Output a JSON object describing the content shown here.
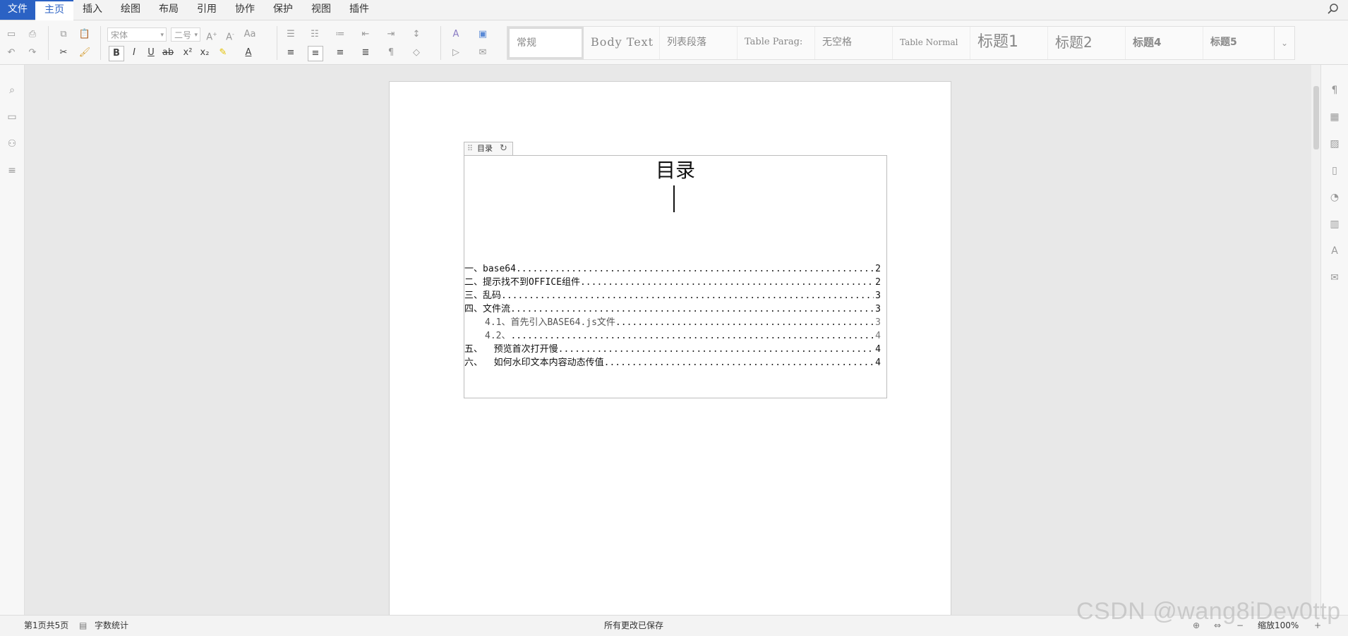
{
  "menu": {
    "file": "文件",
    "tabs": [
      "主页",
      "插入",
      "绘图",
      "布局",
      "引用",
      "协作",
      "保护",
      "视图",
      "插件"
    ],
    "active_index": 0
  },
  "ribbon": {
    "font_name": "宋体",
    "font_size": "二号",
    "styles": [
      "常规",
      "Body Text",
      "列表段落",
      "Table Parag:",
      "无空格",
      "Table Normal",
      "标题1",
      "标题2",
      "标题4",
      "标题5"
    ]
  },
  "toc": {
    "handle_label": "目录",
    "title": "目录",
    "entries": [
      {
        "text": "一、base64",
        "page": "2"
      },
      {
        "text": "二、提示找不到OFFICE组件",
        "page": "2"
      },
      {
        "text": "三、乱码",
        "page": "3"
      },
      {
        "text": "四、文件流",
        "page": "3"
      },
      {
        "text": "4.1、首先引入BASE64.js文件",
        "page": "3"
      },
      {
        "text": "4.2、",
        "page": "4"
      },
      {
        "text": "五、  预览首次打开慢",
        "page": "4"
      },
      {
        "text": "六、  如何水印文本内容动态传值",
        "page": "4"
      }
    ]
  },
  "status": {
    "page_info": "第1页共5页",
    "word_count": "字数统计",
    "save_state": "所有更改已保存",
    "zoom": "缩放100%"
  },
  "watermark": "CSDN @wang8iDev0ttp",
  "colors": {
    "accent": "#2b62c4"
  }
}
